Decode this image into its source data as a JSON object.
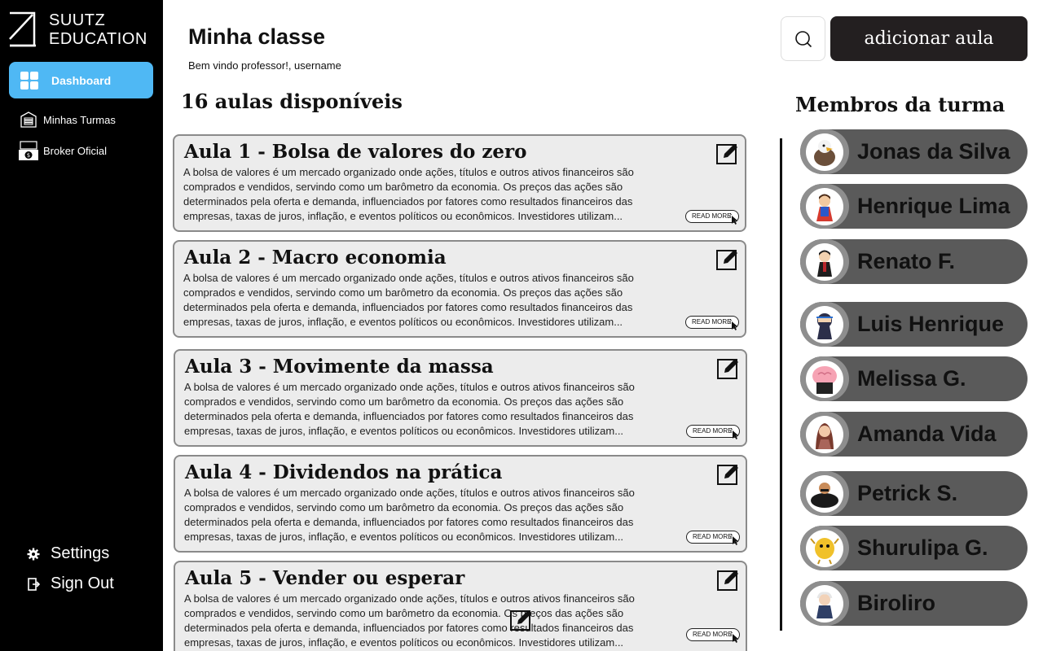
{
  "sidebar": {
    "logo_line1": "SUUTZ",
    "logo_line2": "EDUCATION",
    "nav_active": "Dashboard",
    "nav_items": [
      "Minhas Turmas",
      "Broker Oficial"
    ],
    "bottom_items": [
      "Settings",
      "Sign Out"
    ]
  },
  "header": {
    "title": "Minha classe",
    "subtitle": "Bem vindo professor!, username",
    "add_button": "adicionar aula"
  },
  "lessons": {
    "count_label": "16 aulas disponíveis",
    "read_more": "READ MORE",
    "items": [
      {
        "title": "Aula 1 - Bolsa de valores do zero",
        "description": "A bolsa de valores é um mercado organizado onde ações, títulos e outros ativos financeiros são comprados e vendidos, servindo como um barômetro da economia. Os preços das ações são determinados pela oferta e demanda, influenciados por fatores como resultados financeiros das empresas, taxas de juros, inflação, e eventos políticos ou econômicos. Investidores utilizam..."
      },
      {
        "title": "Aula 2 - Macro economia",
        "description": "A bolsa de valores é um mercado organizado onde ações, títulos e outros ativos financeiros são comprados e vendidos, servindo como um barômetro da economia. Os preços das ações são determinados pela oferta e demanda, influenciados por fatores como resultados financeiros das empresas, taxas de juros, inflação, e eventos políticos ou econômicos. Investidores utilizam..."
      },
      {
        "title": "Aula 3 - Movimente da massa",
        "description": "A bolsa de valores é um mercado organizado onde ações, títulos e outros ativos financeiros são comprados e vendidos, servindo como um barômetro da economia. Os preços das ações são determinados pela oferta e demanda, influenciados por fatores como resultados financeiros das empresas, taxas de juros, inflação, e eventos políticos ou econômicos. Investidores utilizam..."
      },
      {
        "title": "Aula 4 - Dividendos na prática",
        "description": "A bolsa de valores é um mercado organizado onde ações, títulos e outros ativos financeiros são comprados e vendidos, servindo como um barômetro da economia. Os preços das ações são determinados pela oferta e demanda, influenciados por fatores como resultados financeiros das empresas, taxas de juros, inflação, e eventos políticos ou econômicos. Investidores utilizam..."
      },
      {
        "title": "Aula 5 - Vender ou esperar",
        "description": "A bolsa de valores é um mercado organizado onde ações, títulos e outros ativos financeiros são comprados e vendidos, servindo como um barômetro da economia. Os preços das ações são determinados pela oferta e demanda, influenciados por fatores como resultados financeiros das empresas, taxas de juros, inflação, e eventos políticos ou econômicos. Investidores utilizam..."
      }
    ]
  },
  "members": {
    "title": "Membros da turma",
    "items": [
      {
        "name": "Jonas da Silva",
        "avatar_icon": "eagle-avatar-icon"
      },
      {
        "name": "Henrique Lima",
        "avatar_icon": "superhero-avatar-icon"
      },
      {
        "name": "Renato F.",
        "avatar_icon": "wizard-avatar-icon"
      },
      {
        "name": "Luis Henrique",
        "avatar_icon": "ninja-avatar-icon"
      },
      {
        "name": "Melissa G.",
        "avatar_icon": "brain-avatar-icon"
      },
      {
        "name": "Amanda Vida",
        "avatar_icon": "woman-avatar-icon"
      },
      {
        "name": "Petrick S.",
        "avatar_icon": "strongman-avatar-icon"
      },
      {
        "name": "Shurulipa G.",
        "avatar_icon": "creature-avatar-icon"
      },
      {
        "name": "Biroliro",
        "avatar_icon": "old-man-avatar-icon"
      }
    ]
  },
  "colors": {
    "sidebar_bg": "#000000",
    "nav_active_bg": "#4fb8f4",
    "add_button_bg": "#231f20",
    "card_bg": "#ececec",
    "member_bg": "#5a5a5a",
    "avatar_ring": "#8e8e8e"
  }
}
